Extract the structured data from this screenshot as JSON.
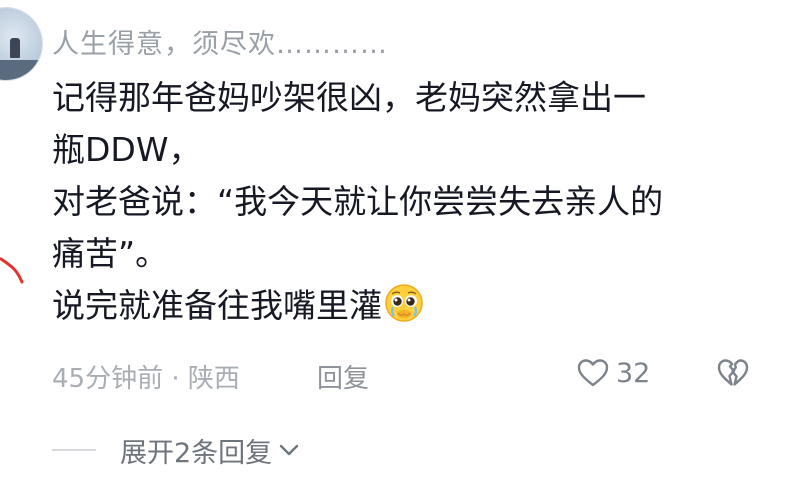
{
  "comment": {
    "username": "人生得意，须尽欢…………",
    "body_lines": [
      "记得那年爸妈吵架很凶，老妈突然拿出一",
      "瓶DDW，",
      "对老爸说：“我今天就让你尝尝失去亲人的",
      "痛苦”。",
      "说完就准备往我嘴里灌"
    ],
    "emoji": "pleading-face-emoji",
    "time_location": "45分钟前 · 陕西",
    "reply_label": "回复",
    "like_count": "32",
    "expand_label": "展开2条回复"
  },
  "icons": {
    "like": "heart-outline-icon",
    "dislike": "broken-heart-outline-icon",
    "expand": "chevron-down-icon"
  },
  "colors": {
    "text": "#161823",
    "muted": "#a9aeb5",
    "annotation": "#e5322d"
  }
}
